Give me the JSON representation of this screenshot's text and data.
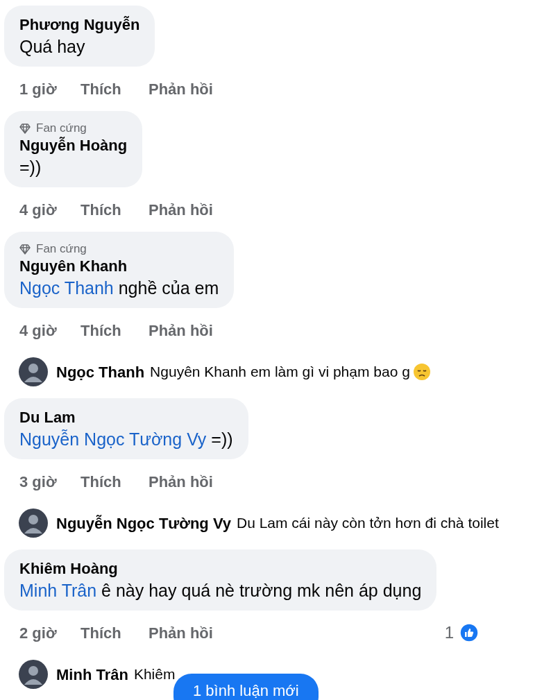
{
  "comments": [
    {
      "kind": "comment",
      "author": "Phương Nguyễn",
      "text": "Quá hay",
      "time": "1 giờ",
      "like": "Thích",
      "reply": "Phản hồi"
    },
    {
      "kind": "comment",
      "badge": "Fan cứng",
      "author": "Nguyễn Hoàng",
      "text": "=))",
      "time": "4 giờ",
      "like": "Thích",
      "reply": "Phản hồi"
    },
    {
      "kind": "comment",
      "badge": "Fan cứng",
      "author": "Nguyên Khanh",
      "mention": "Ngọc Thanh",
      "text": "nghề của em",
      "time": "4 giờ",
      "like": "Thích",
      "reply": "Phản hồi"
    },
    {
      "kind": "reply",
      "author": "Ngọc Thanh",
      "text": "Nguyên Khanh em làm gì vi phạm bao g",
      "emoji": {
        "kind": "sad"
      }
    },
    {
      "kind": "comment",
      "author": "Du Lam",
      "mention": "Nguyễn Ngọc Tường Vy",
      "text": "=))",
      "time": "3 giờ",
      "like": "Thích",
      "reply": "Phản hồi"
    },
    {
      "kind": "reply",
      "author": "Nguyễn Ngọc Tường Vy",
      "text": "Du Lam cái này còn tởn hơn đi chà toilet"
    },
    {
      "kind": "comment",
      "author": "Khiêm Hoàng",
      "mention": "Minh Trân",
      "text": "ê này hay quá nè trường mk nên áp dụng",
      "time": "2 giờ",
      "like": "Thích",
      "reply": "Phản hồi",
      "reactions": "1"
    },
    {
      "kind": "reply",
      "author": "Minh Trân",
      "text": "Khiêm"
    }
  ],
  "new_comments_button": "1 bình luận mới"
}
